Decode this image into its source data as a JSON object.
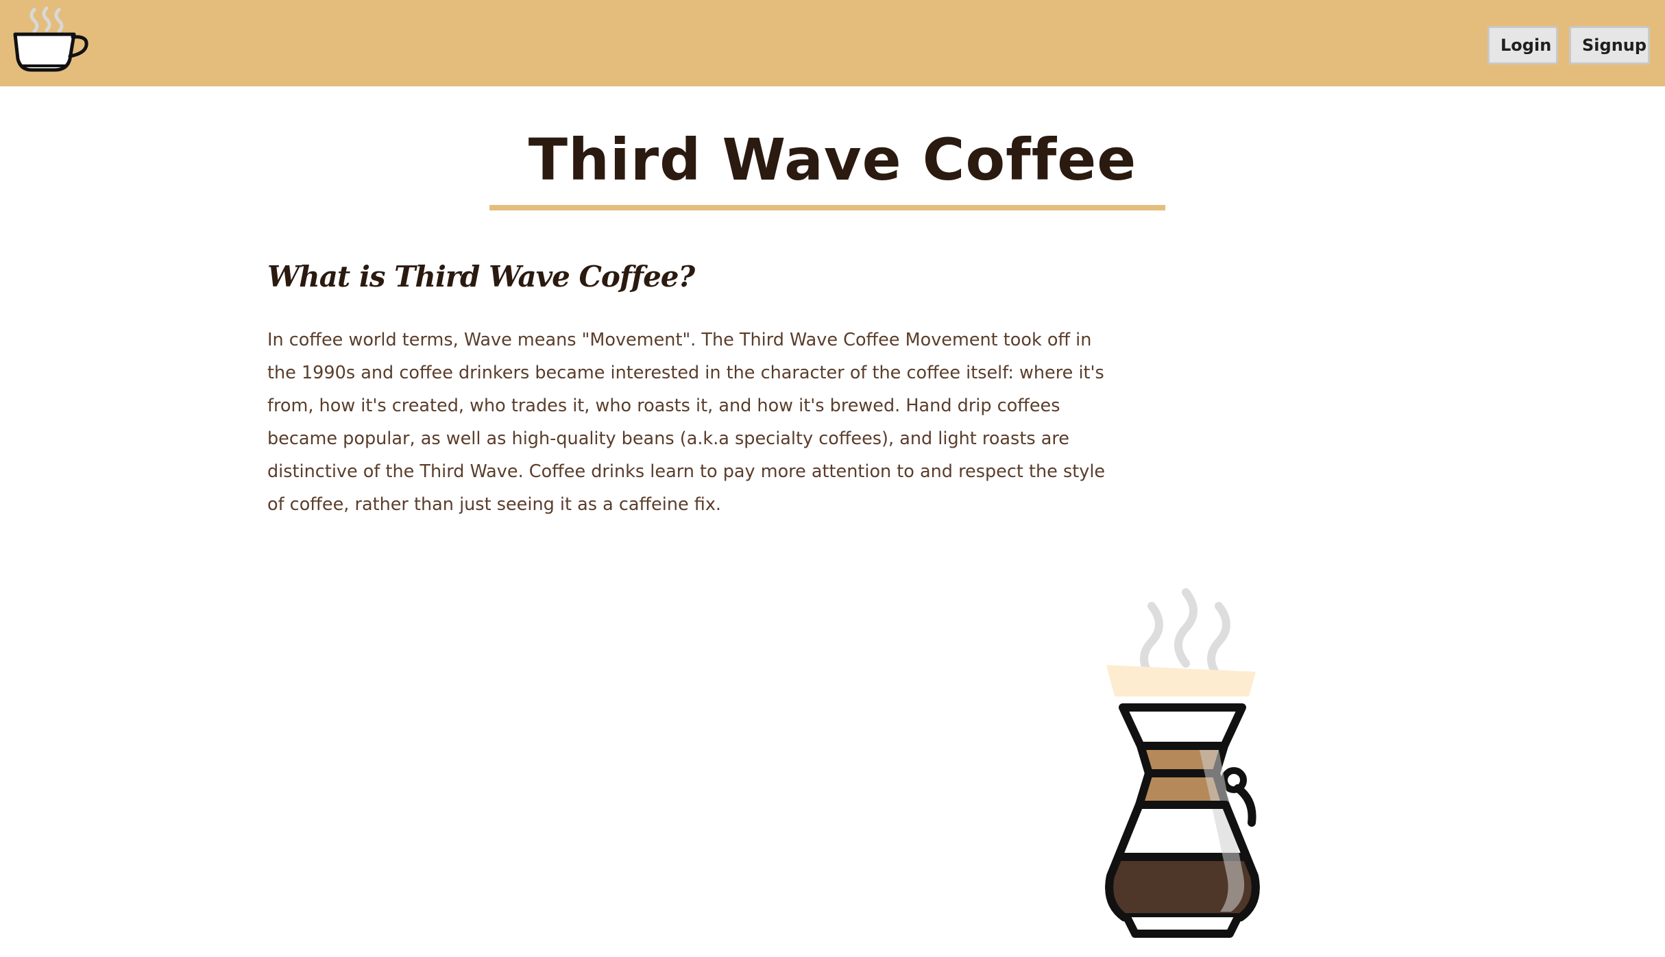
{
  "header": {
    "logo_icon": "coffee-cup-icon",
    "login_label": "Login",
    "signup_label": "Signup",
    "background_color": "#e4bd7d"
  },
  "main": {
    "title": "Third Wave Coffee",
    "subtitle": "What is Third Wave Coffee?",
    "paragraph": "In coffee world terms, Wave means \"Movement\". The Third Wave Coffee Movement took off in the 1990s and coffee drinkers became interested in the character of the coffee itself: where it's from, how it's created, who trades it, who roasts it, and how it's brewed. Hand drip coffees became popular, as well as high-quality beans (a.k.a specialty coffees), and light roasts are distinctive of the Third Wave. Coffee drinks learn to pay more attention to and respect the style of coffee, rather than just seeing it as a caffeine fix.",
    "illustration_icon": "pour-over-coffee-maker-icon"
  },
  "colors": {
    "accent": "#e4bd7d",
    "heading": "#2b1a10",
    "body_text": "#5a3d2b"
  }
}
